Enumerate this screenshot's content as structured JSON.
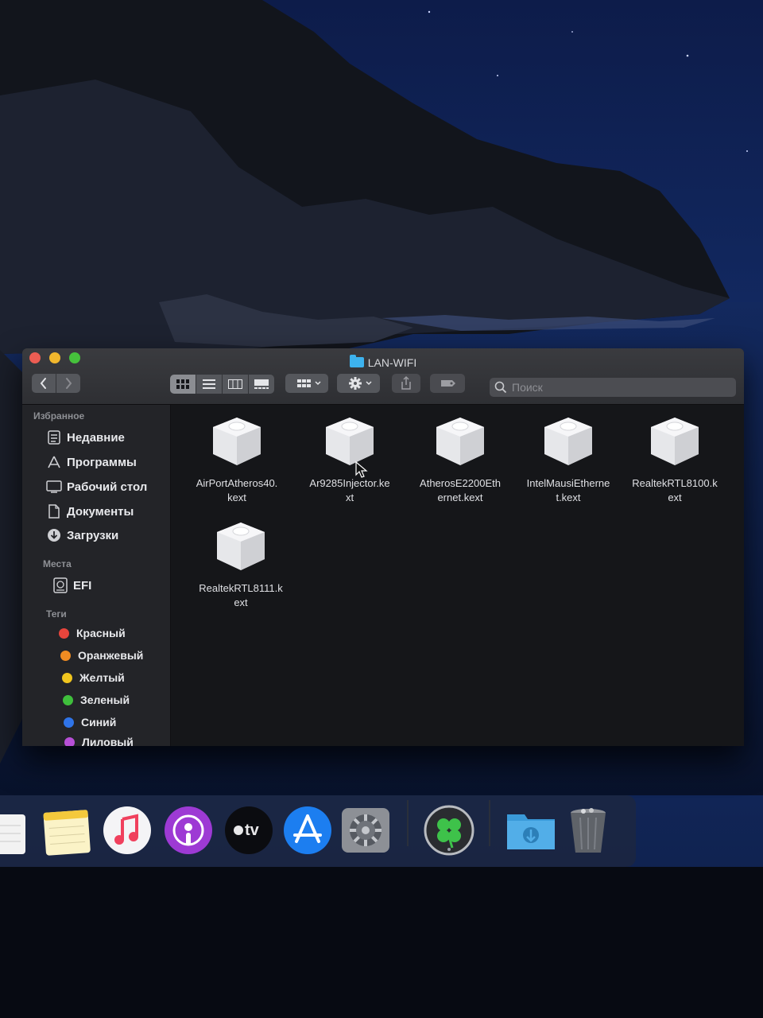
{
  "window": {
    "title": "LAN-WIFI"
  },
  "toolbar": {
    "back_glyph": "‹",
    "forward_glyph": "›",
    "search_placeholder": "Поиск",
    "view_modes": [
      "icon-view",
      "list-view",
      "column-view",
      "gallery-view"
    ]
  },
  "sidebar": {
    "favorites_header": "Избранное",
    "favorites": [
      {
        "label": "Недавние",
        "icon": "recents-icon"
      },
      {
        "label": "Программы",
        "icon": "applications-icon"
      },
      {
        "label": "Рабочий стол",
        "icon": "desktop-icon"
      },
      {
        "label": "Документы",
        "icon": "documents-icon"
      },
      {
        "label": "Загрузки",
        "icon": "downloads-icon"
      }
    ],
    "places_header": "Места",
    "places": [
      {
        "label": "EFI",
        "icon": "disk-icon"
      }
    ],
    "tags_header": "Теги",
    "tags": [
      {
        "label": "Красный",
        "color": "#e8453c"
      },
      {
        "label": "Оранжевый",
        "color": "#f08c22"
      },
      {
        "label": "Желтый",
        "color": "#f0c51e"
      },
      {
        "label": "Зеленый",
        "color": "#3fbf3c"
      },
      {
        "label": "Синий",
        "color": "#2f74e8"
      },
      {
        "label": "Лиловый",
        "color": "#b64fd6"
      }
    ]
  },
  "files": [
    {
      "line1": "AirPortAtheros40.",
      "line2": "kext",
      "icon": "kext-bundle-icon"
    },
    {
      "line1": "Ar9285Injector.ke",
      "line2": "xt",
      "icon": "kext-bundle-icon"
    },
    {
      "line1": "AtherosE2200Eth",
      "line2": "ernet.kext",
      "icon": "kext-bundle-icon"
    },
    {
      "line1": "IntelMausiEtherne",
      "line2": "t.kext",
      "icon": "kext-bundle-icon"
    },
    {
      "line1": "RealtekRTL8100.k",
      "line2": "ext",
      "icon": "kext-bundle-icon"
    },
    {
      "line1": "RealtekRTL8111.k",
      "line2": "ext",
      "icon": "kext-bundle-icon"
    }
  ],
  "dock": {
    "apps": [
      "notes-icon",
      "music-icon",
      "podcasts-icon",
      "apple-tv-icon",
      "app-store-icon",
      "system-preferences-icon",
      "clover-configurator-icon",
      "downloads-folder-icon",
      "trash-icon"
    ],
    "tv_label": "tv"
  },
  "colors": {
    "window_bg": "#151619",
    "sidebar_bg": "#232428",
    "folder_accent": "#3db2ee"
  }
}
